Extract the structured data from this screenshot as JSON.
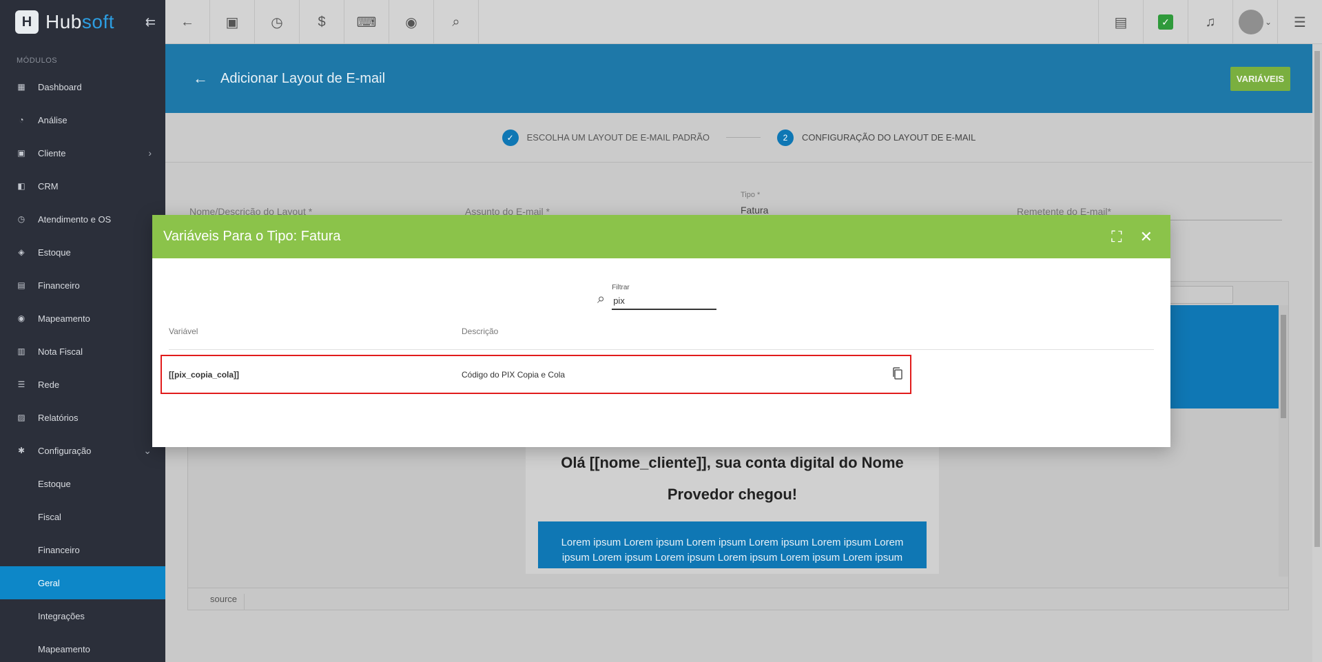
{
  "brand": {
    "name_a": "Hub",
    "name_b": "soft"
  },
  "sidebar": {
    "section": "MÓDULOS",
    "items": [
      {
        "label": "Dashboard"
      },
      {
        "label": "Análise"
      },
      {
        "label": "Cliente"
      },
      {
        "label": "CRM"
      },
      {
        "label": "Atendimento e OS"
      },
      {
        "label": "Estoque"
      },
      {
        "label": "Financeiro"
      },
      {
        "label": "Mapeamento"
      },
      {
        "label": "Nota Fiscal"
      },
      {
        "label": "Rede"
      },
      {
        "label": "Relatórios"
      },
      {
        "label": "Configuração"
      }
    ],
    "subitems": [
      {
        "label": "Estoque"
      },
      {
        "label": "Fiscal"
      },
      {
        "label": "Financeiro"
      },
      {
        "label": "Geral"
      },
      {
        "label": "Integrações"
      },
      {
        "label": "Mapeamento"
      }
    ]
  },
  "page": {
    "title": "Adicionar Layout de E-mail",
    "variables_button": "VARIÁVEIS"
  },
  "stepper": {
    "step1": "ESCOLHA UM LAYOUT DE E-MAIL PADRÃO",
    "step2_number": "2",
    "step2": "CONFIGURAÇÃO DO LAYOUT DE E-MAIL"
  },
  "form": {
    "name_label": "Nome/Descrição do Layout *",
    "subject_label": "Assunto do E-mail *",
    "type_label": "Tipo *",
    "type_value": "Fatura",
    "sender_label": "Remetente do E-mail*"
  },
  "editor": {
    "heading": "Olá [[nome_cliente]], sua conta digital do Nome Provedor chegou!",
    "lorem": "Lorem ipsum Lorem ipsum Lorem ipsum Lorem ipsum Lorem ipsum Lorem ipsum Lorem ipsum Lorem ipsum Lorem ipsum Lorem ipsum Lorem ipsum Lorem ipsum Lorem",
    "source_tab": "source"
  },
  "modal": {
    "title": "Variáveis Para o Tipo: Fatura",
    "filter_label": "Filtrar",
    "filter_value": "pix",
    "columns": {
      "variable": "Variável",
      "description": "Descrição"
    },
    "rows": [
      {
        "variable": "[[pix_copia_cola]]",
        "description": "Código do PIX Copia e Cola"
      }
    ]
  },
  "colors": {
    "sidebar": "#2b2f3a",
    "accent": "#0d87c8",
    "modal_header": "#8bc34a",
    "highlight": "#e11b1b"
  }
}
